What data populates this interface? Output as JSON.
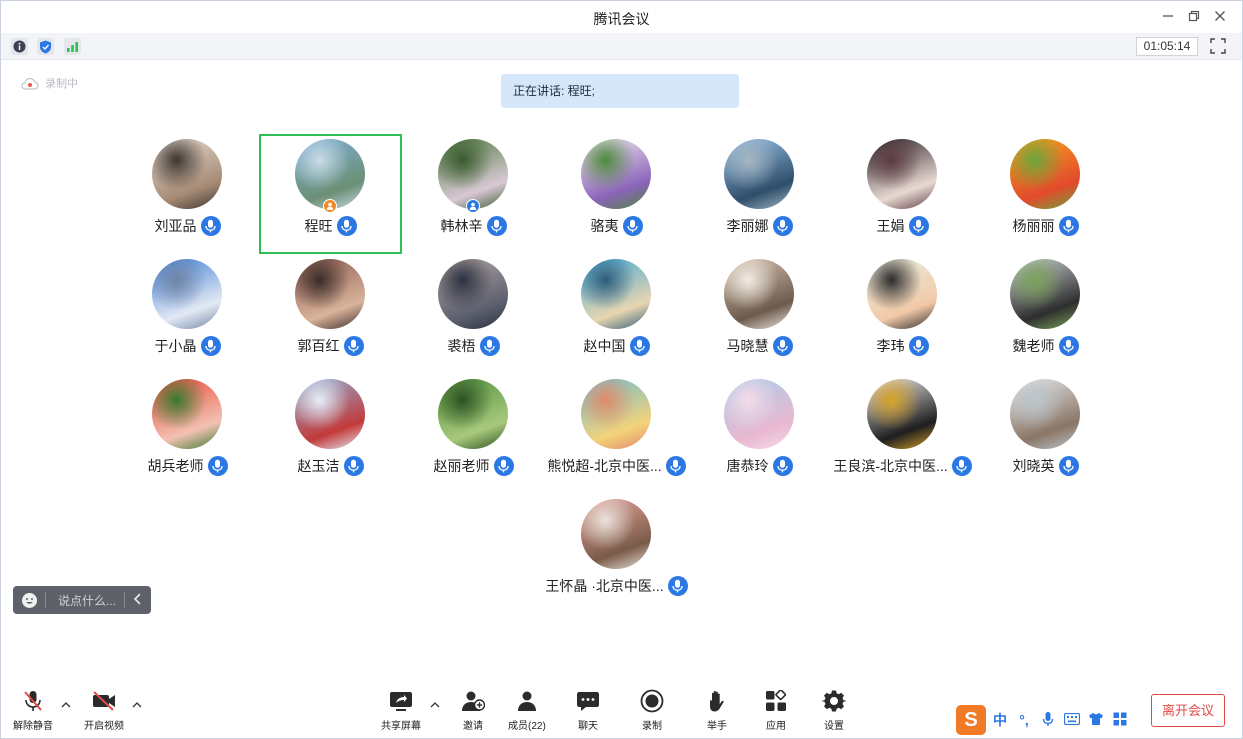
{
  "window": {
    "title": "腾讯会议"
  },
  "topbar": {
    "timer": "01:05:14"
  },
  "recording_label": "录制中",
  "speaking_banner": "正在讲话: 程旺;",
  "participants": [
    {
      "name": "刘亚品",
      "avatar_colors": [
        "#e8ddd2",
        "#a68a74",
        "#3d3530"
      ]
    },
    {
      "name": "程旺",
      "active": true,
      "badge": "host",
      "avatar_colors": [
        "#7fb1d9",
        "#6b8f75",
        "#c9dce8"
      ]
    },
    {
      "name": "韩林辛",
      "badge": "cohost",
      "avatar_colors": [
        "#4e7a3c",
        "#d9c8d4",
        "#3a5b30"
      ]
    },
    {
      "name": "骆夷",
      "avatar_colors": [
        "#f5f0f6",
        "#8a63b8",
        "#4f8a3a"
      ]
    },
    {
      "name": "李丽娜",
      "avatar_colors": [
        "#9ec4e8",
        "#2d4e6b",
        "#a4b7c4"
      ]
    },
    {
      "name": "王娟",
      "avatar_colors": [
        "#2a1f25",
        "#e8d9d2",
        "#5b3b41"
      ]
    },
    {
      "name": "杨丽丽",
      "avatar_colors": [
        "#f6a51e",
        "#e24a2c",
        "#6aa73b"
      ]
    },
    {
      "name": "于小晶",
      "avatar_colors": [
        "#3f7fd6",
        "#e3e9f4",
        "#6d84a6"
      ]
    },
    {
      "name": "郭百红",
      "avatar_colors": [
        "#8a5a4c",
        "#d9b39b",
        "#3a2b28"
      ]
    },
    {
      "name": "裘梧",
      "avatar_colors": [
        "#b7a7a3",
        "#5b5f6e",
        "#2b3040"
      ]
    },
    {
      "name": "赵中国",
      "avatar_colors": [
        "#3fa7d8",
        "#e8d6b0",
        "#2e5d7a"
      ]
    },
    {
      "name": "马晓慧",
      "avatar_colors": [
        "#d8c6b4",
        "#6e5a4c",
        "#f2ece4"
      ]
    },
    {
      "name": "李玮",
      "avatar_colors": [
        "#e7f0e0",
        "#f2c9a8",
        "#2b2b2b"
      ]
    },
    {
      "name": "魏老师",
      "avatar_colors": [
        "#cfd6db",
        "#2e2e2e",
        "#7ca35b"
      ]
    },
    {
      "name": "胡兵老师",
      "avatar_colors": [
        "#e8483a",
        "#f2c1b2",
        "#3a7a2e"
      ]
    },
    {
      "name": "赵玉洁",
      "avatar_colors": [
        "#8fb4dc",
        "#c23a3a",
        "#e6eef6"
      ]
    },
    {
      "name": "赵丽老师",
      "avatar_colors": [
        "#4f8f3b",
        "#a8c87c",
        "#2d5222"
      ]
    },
    {
      "name": "熊悦超-北京中医...",
      "avatar_colors": [
        "#6bbfd4",
        "#f3d27a",
        "#e08a6a"
      ]
    },
    {
      "name": "唐恭玲",
      "avatar_colors": [
        "#a9cde9",
        "#e9b8d1",
        "#f5dce9"
      ]
    },
    {
      "name": "王良滨-北京中医...",
      "avatar_colors": [
        "#f1f1f1",
        "#1e1e1e",
        "#d8a22a"
      ]
    },
    {
      "name": "刘晓英",
      "avatar_colors": [
        "#e8ecef",
        "#8a7666",
        "#bcc6cc"
      ]
    },
    {
      "name": "王怀晶 ·北京中医...",
      "avatar_colors": [
        "#e9a8a0",
        "#7a5a48",
        "#e8e3dc"
      ]
    }
  ],
  "chat": {
    "placeholder": "说点什么..."
  },
  "toolbar": {
    "unmute": "解除静音",
    "start_video": "开启视频",
    "share_screen": "共享屏幕",
    "invite": "邀请",
    "members": "成员(22)",
    "chat": "聊天",
    "record": "录制",
    "raise_hand": "举手",
    "apps": "应用",
    "settings": "设置",
    "leave": "离开会议"
  },
  "ime": {
    "s": "S",
    "mode": "中",
    "punct": "°,"
  },
  "colors": {
    "accent": "#2b78e4",
    "active_border": "#2fbf55",
    "leave": "#e14b47"
  }
}
